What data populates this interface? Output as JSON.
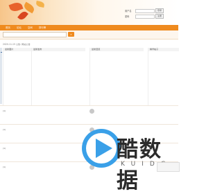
{
  "header": {
    "login_label_user": "用户名",
    "login_label_pass": "密码",
    "login_button": "登录",
    "register_button": "注册",
    "colors": {
      "banner_accent": "#f7c58a",
      "nav": "#ef8a1e"
    }
  },
  "nav": {
    "items": [
      "首页",
      "论坛",
      "空间",
      "排行榜"
    ]
  },
  "subnav": {
    "search_placeholder": "",
    "search_button_icon": "search-icon"
  },
  "notice": {
    "text": "2020-11-15 公告: 网站公告"
  },
  "columns": [
    {
      "header": "最新图片",
      "items": [
        "",
        "",
        "",
        "",
        "",
        "",
        "",
        "",
        "",
        "",
        "",
        "",
        ""
      ]
    },
    {
      "header": "最新发布",
      "items": [
        "",
        "",
        "",
        "",
        "",
        "",
        "",
        "",
        "",
        "",
        "",
        "",
        ""
      ]
    },
    {
      "header": "最新回复",
      "items": [
        "",
        "",
        "",
        "",
        "",
        "",
        "",
        "",
        "",
        "",
        "",
        "",
        ""
      ]
    },
    {
      "header": "精华帖子",
      "items": [
        "",
        "",
        "",
        "",
        "",
        "",
        "",
        "",
        "",
        "",
        "",
        "",
        ""
      ]
    }
  ],
  "threads": [
    {
      "left1": "(1)",
      "left2": "",
      "title": "",
      "meta": "",
      "meta2": ""
    },
    {
      "left1": "(1)",
      "left2": "",
      "title": "",
      "meta": "",
      "meta2": ""
    },
    {
      "left1": "(1)",
      "left2": "",
      "title": "",
      "meta": "",
      "meta2": ""
    },
    {
      "left1": "(1)",
      "left2": "",
      "title": "",
      "meta": "",
      "meta2": ""
    }
  ],
  "watermark": {
    "main": "酷数据",
    "sub": "KUIDC"
  },
  "tag": {
    "text": ""
  }
}
